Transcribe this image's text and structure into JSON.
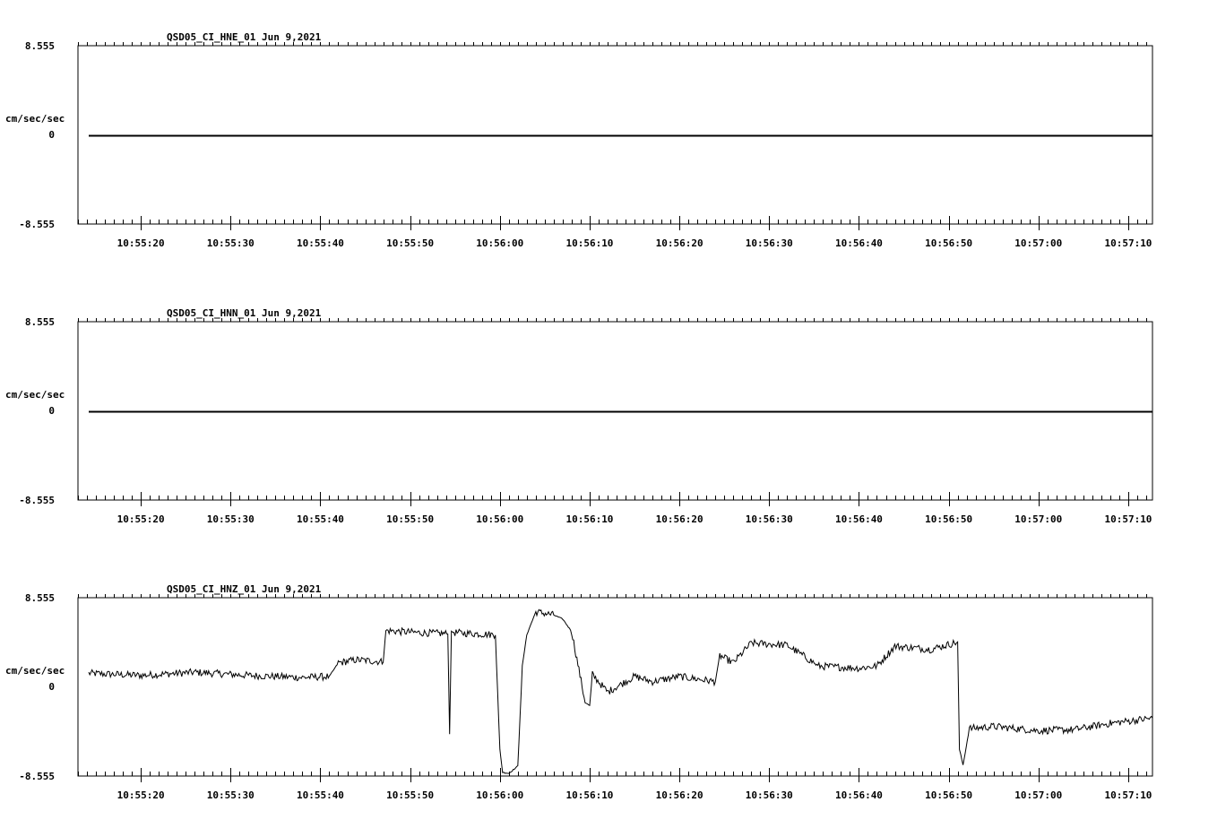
{
  "chart_data": [
    {
      "type": "line",
      "title": "QSD05_CI_HNE_01  Jun 9,2021",
      "ylabel": "cm/sec/sec",
      "ylim": [
        -8.555,
        8.555
      ],
      "y_ticks": [
        "8.555",
        "0",
        "-8.555"
      ],
      "x_range_seconds": [
        "10:55:13.0",
        "10:57:12.7"
      ],
      "x_ticks": [
        "10:55:20",
        "10:55:30",
        "10:55:40",
        "10:55:50",
        "10:56:00",
        "10:56:10",
        "10:56:20",
        "10:56:30",
        "10:56:40",
        "10:56:50",
        "10:57:00",
        "10:57:10"
      ],
      "series": [
        {
          "t": [
            "10:55:14.2",
            "10:57:12.7"
          ],
          "values": [
            0,
            0
          ]
        }
      ]
    },
    {
      "type": "line",
      "title": "QSD05_CI_HNN_01  Jun 9,2021",
      "ylabel": "cm/sec/sec",
      "ylim": [
        -8.555,
        8.555
      ],
      "y_ticks": [
        "8.555",
        "0",
        "-8.555"
      ],
      "x_range_seconds": [
        "10:55:13.0",
        "10:57:12.7"
      ],
      "x_ticks": [
        "10:55:20",
        "10:55:30",
        "10:55:40",
        "10:55:50",
        "10:56:00",
        "10:56:10",
        "10:56:20",
        "10:56:30",
        "10:56:40",
        "10:56:50",
        "10:57:00",
        "10:57:10"
      ],
      "series": [
        {
          "t": [
            "10:55:14.2",
            "10:57:12.7"
          ],
          "values": [
            0,
            0
          ]
        }
      ]
    },
    {
      "type": "line",
      "title": "QSD05_CI_HNZ_01  Jun 9,2021",
      "ylabel": "cm/sec/sec",
      "ylim": [
        -8.555,
        8.555
      ],
      "y_ticks": [
        "8.555",
        "0",
        "-8.555"
      ],
      "x_range_seconds": [
        "10:55:13.0",
        "10:57:12.7"
      ],
      "x_ticks": [
        "10:55:20",
        "10:55:30",
        "10:55:40",
        "10:55:50",
        "10:56:00",
        "10:56:10",
        "10:56:20",
        "10:56:30",
        "10:56:40",
        "10:56:50",
        "10:57:00",
        "10:57:10"
      ],
      "series": [
        {
          "t": [
            "10:55:14.2",
            "10:55:20",
            "10:55:26",
            "10:55:32",
            "10:55:38",
            "10:55:41",
            "10:55:42",
            "10:55:44",
            "10:55:47",
            "10:55:47.3",
            "10:55:51",
            "10:55:54.2",
            "10:55:54.4",
            "10:55:54.6",
            "10:55:55",
            "10:55:59.5",
            "10:56:00",
            "10:56:00.3",
            "10:56:01",
            "10:56:02",
            "10:56:02.5",
            "10:56:03",
            "10:56:04",
            "10:56:06",
            "10:56:07",
            "10:56:08",
            "10:56:09.5",
            "10:56:10",
            "10:56:10.3",
            "10:56:12",
            "10:56:15",
            "10:56:17",
            "10:56:20",
            "10:56:24",
            "10:56:24.5",
            "10:56:26",
            "10:56:28",
            "10:56:32",
            "10:56:35",
            "10:56:35.3",
            "10:56:40",
            "10:56:42",
            "10:56:44",
            "10:56:48",
            "10:56:51",
            "10:56:51.2",
            "10:56:51.6",
            "10:56:52.3",
            "10:56:55",
            "10:57:00",
            "10:57:04",
            "10:57:06",
            "10:57:08",
            "10:57:12.7"
          ],
          "values": [
            1.3,
            1.1,
            1.4,
            1.1,
            0.9,
            1.0,
            2.3,
            2.6,
            2.4,
            5.4,
            5.2,
            5.1,
            -4.5,
            5.3,
            5.2,
            5.0,
            -6.0,
            -8.2,
            -8.3,
            -7.6,
            2.0,
            5.0,
            7.2,
            6.9,
            6.5,
            5.3,
            -1.5,
            -1.8,
            1.2,
            -0.5,
            1.0,
            0.5,
            1.0,
            0.5,
            3.0,
            2.3,
            4.2,
            4.0,
            2.3,
            2.0,
            1.8,
            2.0,
            3.9,
            3.6,
            4.3,
            -6.0,
            -7.5,
            -4.0,
            -3.8,
            -4.2,
            -4.1,
            -3.8,
            -3.5,
            -3.0
          ]
        }
      ]
    }
  ]
}
